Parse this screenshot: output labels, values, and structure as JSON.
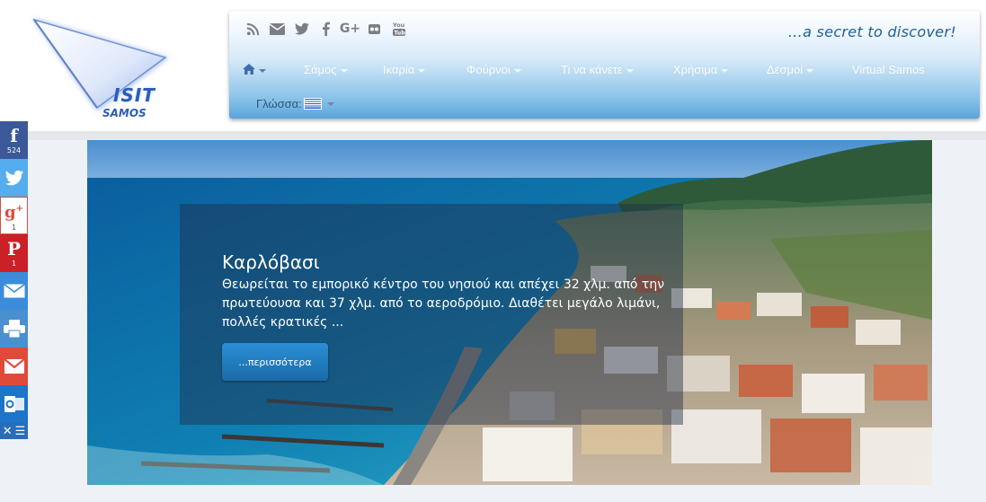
{
  "logo": {
    "visit": "ISIT",
    "samos": "SAMOS"
  },
  "header": {
    "social_icons": [
      "rss-icon",
      "mail-icon",
      "twitter-icon",
      "facebook-icon",
      "google-plus-icon",
      "flickr-icon",
      "youtube-icon"
    ],
    "tagline": "...a secret to discover!",
    "menu": [
      {
        "label": ""
      },
      {
        "label": "Σάμος"
      },
      {
        "label": "Ικαρία"
      },
      {
        "label": "Φούρνοι"
      },
      {
        "label": "Τι να κάνετε"
      },
      {
        "label": "Χρήσιμα"
      },
      {
        "label": "Δεσμοί"
      },
      {
        "label": "Virtual Samos"
      }
    ],
    "language_label": "Γλώσσα:"
  },
  "hero": {
    "title": "Καρλόβασι",
    "text": "Θεωρείται το εμπορικό κέντρο του νησιού και απέχει 32 χλμ. από την πρωτεύουσα και 37 χλμ. από το αεροδρόμιο. Διαθέτει μεγάλο λιμάνι, πολλές κρατικές ...",
    "button": "...περισσότερα"
  },
  "share_bar": {
    "facebook_count": "524",
    "googleplus_count": "1",
    "pinterest_count": "1"
  },
  "colors": {
    "nav_gradient_top": "#ffffff",
    "nav_gradient_bottom": "#5aa5dc",
    "tagline": "#1f5f93",
    "facebook": "#3b5998",
    "twitter": "#55acee",
    "pinterest": "#cb2027",
    "gmail": "#e04a39"
  }
}
